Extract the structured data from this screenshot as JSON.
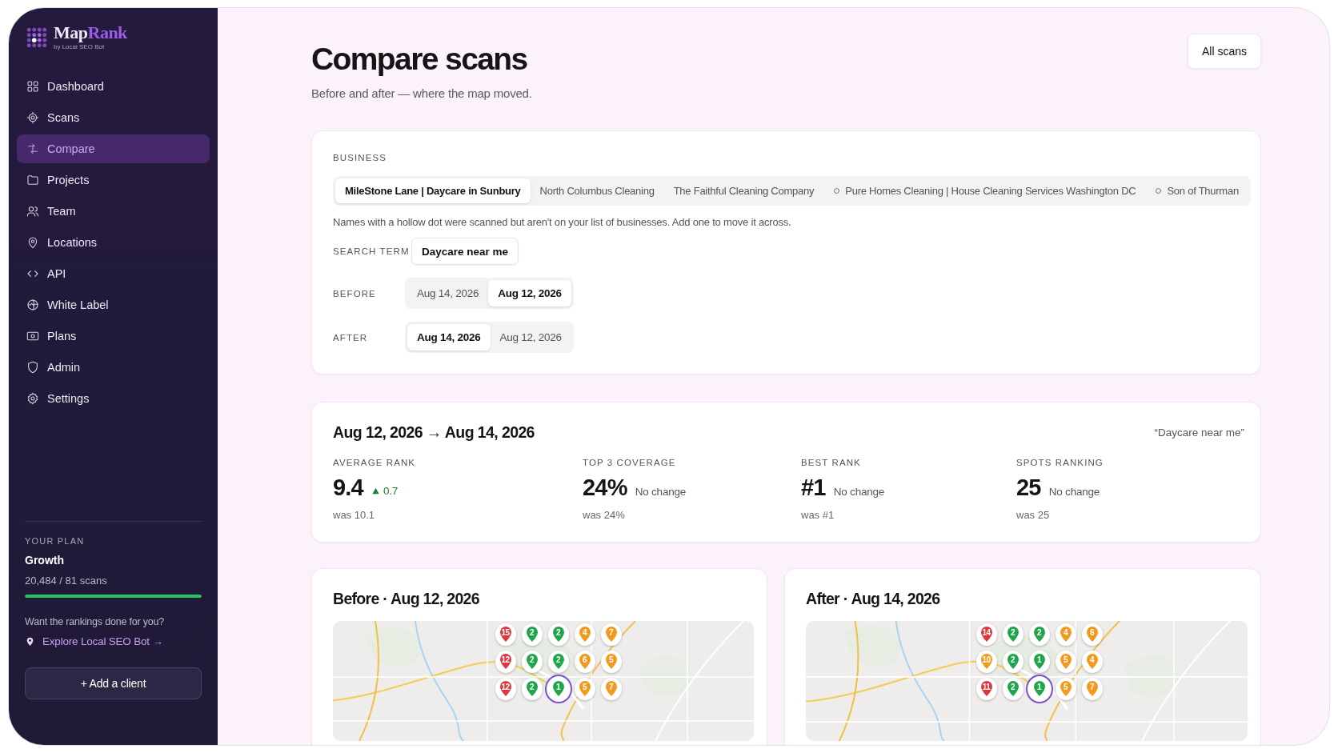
{
  "brand": {
    "name_start": "Map",
    "name_end": "Rank",
    "tagline": "by Local SEO Bot"
  },
  "sidebar": {
    "items": [
      {
        "label": "Dashboard",
        "selected": false
      },
      {
        "label": "Scans",
        "selected": false
      },
      {
        "label": "Compare",
        "selected": true
      },
      {
        "label": "Projects",
        "selected": false
      },
      {
        "label": "Team",
        "selected": false
      },
      {
        "label": "Locations",
        "selected": false
      },
      {
        "label": "API",
        "selected": false
      },
      {
        "label": "White Label",
        "selected": false
      },
      {
        "label": "Plans",
        "selected": false
      },
      {
        "label": "Admin",
        "selected": false
      },
      {
        "label": "Settings",
        "selected": false
      }
    ]
  },
  "plan": {
    "heading": "YOUR PLAN",
    "name": "Growth",
    "usage": "20,484 / 81 scans",
    "level": 1,
    "prompt": "Want the rankings done for you?",
    "link": "Explore Local SEO Bot →"
  },
  "add_button": "+ Add a client",
  "page": {
    "title": "Compare scans",
    "subtitle": "Before and after — where the map moved.",
    "action": "All scans"
  },
  "business": {
    "label": "BUSINESS",
    "options": [
      {
        "name": "MileStone Lane | Daycare in Sunbury",
        "selected": true,
        "tracked": true
      },
      {
        "name": "North Columbus Cleaning",
        "selected": false,
        "tracked": true
      },
      {
        "name": "The Faithful Cleaning Company",
        "selected": false,
        "tracked": true
      },
      {
        "name": "Pure Homes Cleaning | House Cleaning Services Washington DC",
        "selected": false,
        "tracked": false
      },
      {
        "name": "Son of Thurman",
        "selected": false,
        "tracked": false
      }
    ],
    "note": "Names with a hollow dot were scanned but aren't on your list of businesses. Add one to move it across."
  },
  "search_term": {
    "label": "SEARCH TERM",
    "value": "Daycare near me"
  },
  "before": {
    "label": "BEFORE",
    "options": [
      {
        "label": "Aug 14, 2026",
        "selected": false
      },
      {
        "label": "Aug 12, 2026",
        "selected": true
      }
    ]
  },
  "after": {
    "label": "AFTER",
    "options": [
      {
        "label": "Aug 14, 2026",
        "selected": true
      },
      {
        "label": "Aug 12, 2026",
        "selected": false
      }
    ]
  },
  "summary": {
    "range": "Aug 12, 2026 → Aug 14, 2026",
    "query": "“Daycare near me”",
    "metrics": [
      {
        "label": "AVERAGE RANK",
        "value": "9.4",
        "change": "0.7",
        "improved": true,
        "was": "was 10.1"
      },
      {
        "label": "TOP 3 COVERAGE",
        "value": "24%",
        "change": "No change",
        "improved": false,
        "was": "was 24%"
      },
      {
        "label": "BEST RANK",
        "value": "#1",
        "change": "No change",
        "improved": false,
        "was": "was #1"
      },
      {
        "label": "SPOTS RANKING",
        "value": "25",
        "change": "No change",
        "improved": false,
        "was": "was 25"
      }
    ]
  },
  "maps": [
    {
      "title": "Before · Aug 12, 2026",
      "pins": [
        {
          "label": "15",
          "color": "#e0353d",
          "center": false
        },
        {
          "label": "2",
          "color": "#1fa54a",
          "center": false
        },
        {
          "label": "2",
          "color": "#1fa54a",
          "center": false
        },
        {
          "label": "4",
          "color": "#f39a1c",
          "center": false
        },
        {
          "label": "7",
          "color": "#f39a1c",
          "center": false
        },
        {
          "label": "12",
          "color": "#e0353d",
          "center": false
        },
        {
          "label": "2",
          "color": "#1fa54a",
          "center": false
        },
        {
          "label": "2",
          "color": "#1fa54a",
          "center": false
        },
        {
          "label": "6",
          "color": "#f39a1c",
          "center": false
        },
        {
          "label": "5",
          "color": "#f39a1c",
          "center": false
        },
        {
          "label": "12",
          "color": "#e0353d",
          "center": false
        },
        {
          "label": "2",
          "color": "#1fa54a",
          "center": false
        },
        {
          "label": "1",
          "color": "#1fa54a",
          "center": true
        },
        {
          "label": "5",
          "color": "#f39a1c",
          "center": false
        },
        {
          "label": "7",
          "color": "#f39a1c",
          "center": false
        }
      ]
    },
    {
      "title": "After · Aug 14, 2026",
      "pins": [
        {
          "label": "14",
          "color": "#e0353d",
          "center": false
        },
        {
          "label": "2",
          "color": "#1fa54a",
          "center": false
        },
        {
          "label": "2",
          "color": "#1fa54a",
          "center": false
        },
        {
          "label": "4",
          "color": "#f39a1c",
          "center": false
        },
        {
          "label": "6",
          "color": "#f39a1c",
          "center": false
        },
        {
          "label": "10",
          "color": "#f39a1c",
          "center": false
        },
        {
          "label": "2",
          "color": "#1fa54a",
          "center": false
        },
        {
          "label": "1",
          "color": "#1fa54a",
          "center": false
        },
        {
          "label": "5",
          "color": "#f39a1c",
          "center": false
        },
        {
          "label": "4",
          "color": "#f39a1c",
          "center": false
        },
        {
          "label": "11",
          "color": "#e0353d",
          "center": false
        },
        {
          "label": "2",
          "color": "#1fa54a",
          "center": false
        },
        {
          "label": "1",
          "color": "#1fa54a",
          "center": true
        },
        {
          "label": "5",
          "color": "#f39a1c",
          "center": false
        },
        {
          "label": "7",
          "color": "#f39a1c",
          "center": false
        }
      ]
    }
  ]
}
